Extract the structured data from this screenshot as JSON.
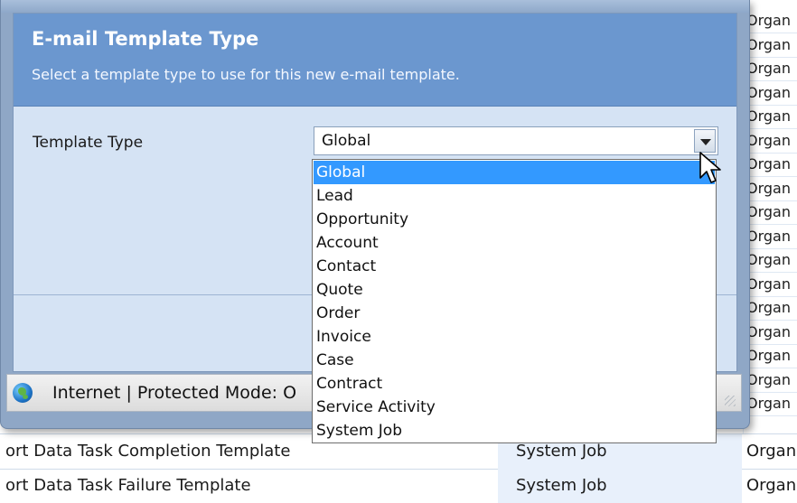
{
  "background_list": {
    "right_column_values": [
      "Organ",
      "Organ",
      "Organ",
      "Organ",
      "Organ",
      "Organ",
      "Organ",
      "Organ",
      "Organ",
      "Organ",
      "Organ",
      "Organ",
      "Organ",
      "Organ",
      "Organ",
      "Organ",
      "Organ",
      "Organ"
    ],
    "rows": [
      {
        "name": "ort Data Task Completion Template",
        "type": "System Job",
        "owner": "Organ"
      },
      {
        "name": "ort Data Task Failure Template",
        "type": "System Job",
        "owner": "Organ"
      }
    ]
  },
  "dialog": {
    "title": "E-mail Template Type",
    "subtitle": "Select a template type to use for this new e-mail template.",
    "field_label": "Template Type",
    "selected_value": "Global"
  },
  "dropdown": {
    "options": [
      "Global",
      "Lead",
      "Opportunity",
      "Account",
      "Contact",
      "Quote",
      "Order",
      "Invoice",
      "Case",
      "Contract",
      "Service Activity",
      "System Job"
    ],
    "selected_index": 0
  },
  "status_bar": {
    "text": "Internet | Protected Mode: O"
  },
  "colors": {
    "header_blue": "#6b97cf",
    "dialog_bg": "#d5e3f4",
    "selection_blue": "#3399ff"
  },
  "icons": {
    "status_zone": "globe-icon",
    "dropdown": "chevron-down-icon",
    "cursor": "mouse-pointer-icon"
  }
}
